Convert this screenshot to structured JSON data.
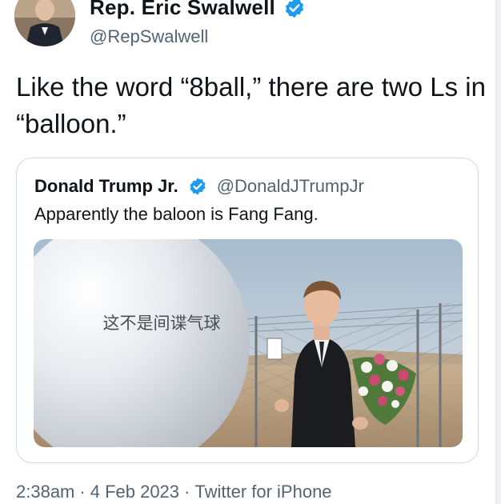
{
  "tweet": {
    "author_name": "Rep. Eric Swalwell",
    "author_handle": "@RepSwalwell",
    "text": "Like the word “8ball,” there are two Ls in “balloon.”",
    "icons": {
      "avatar": "profile-photo",
      "verified": "verified-badge-icon"
    },
    "colors": {
      "verified": "#1d9bf0",
      "secondary_text": "#536471",
      "primary_text": "#0f1419",
      "card_border": "#cfd9de"
    }
  },
  "quoted_tweet": {
    "author_name": "Donald Trump Jr.",
    "author_handle": "@DonaldJTrumpJr",
    "text": "Apparently the baloon is Fang Fang.",
    "media": {
      "balloon_caption": "这不是间谍气球"
    }
  },
  "footer": {
    "time": "2:38am",
    "date": "4 Feb 2023",
    "source": "Twitter for iPhone",
    "separator": "·"
  }
}
